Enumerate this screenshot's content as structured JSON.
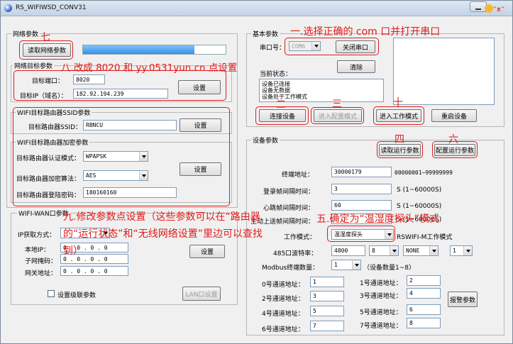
{
  "window": {
    "title": "RS_WIFIWSD_CONV31"
  },
  "network": {
    "legend": "网络参数",
    "read_button": "读取网络参数",
    "progress_fraction": 0.78,
    "target_legend": "网络目标参数",
    "port_label": "目标端口：",
    "port_value": "8020",
    "ip_label": "目标IP（域名）：",
    "ip_value": "182.92.194.239",
    "set_button_1": "设置",
    "ssid_legend": "WIFI目标路由器SSID参数",
    "ssid_label": "目标路由器SSID：",
    "ssid_value": "RBNCU",
    "set_button_2": "设置",
    "enc_legend": "WIFI目标路由器加密参数",
    "auth_label": "目标路由器认证模式：",
    "auth_value": "WPAPSK",
    "algo_label": "目标路由器加密算法：",
    "algo_value": "AES",
    "pwd_label": "目标路由器登陆密码：",
    "pwd_value": "180160160",
    "set_button_3": "设置"
  },
  "wifi_wan": {
    "legend": "WIFI-WAN口参数",
    "ip_mode_label": "IP获取方式：",
    "ip_mode_value": "",
    "local_ip_label": "本地IP：",
    "local_ip_value": "0 . 0 . 0 . 0",
    "mask_label": "子网掩码：",
    "mask_value": "0 . 0 . 0 . 0",
    "gateway_label": "网关地址：",
    "gateway_value": "0 . 0 . 0 . 0",
    "set_button": "设置",
    "cascade_label": "设置级联参数",
    "lan_button": "LAN口设置"
  },
  "basic": {
    "legend": "基本参数",
    "port_label": "串口号：",
    "port_value": "COM6",
    "close_button": "关闭串口",
    "clear_button": "清除",
    "status_label": "当前状态：",
    "status_lines": [
      "设备已连接",
      "设备无数据",
      "设备处于工作模式"
    ],
    "connect_button": "连接设备",
    "config_button": "进入配置模式",
    "work_button": "进入工作模式",
    "restart_button": "重启设备"
  },
  "device": {
    "legend": "设备参数",
    "read_run_button": "读取运行参数",
    "config_run_button": "配置运行参数",
    "terminal_label": "终端地址：",
    "terminal_value": "30000179",
    "terminal_range": "00000001~99999999",
    "login_label": "登录帧间隔时间：",
    "login_value": "3",
    "login_unit": "S (1~60000S)",
    "heartbeat_label": "心跳帧间隔时间：",
    "heartbeat_value": "60",
    "heartbeat_unit": "S (1~60000S)",
    "report_label": "主动上送帧间隔时间：",
    "report_value": "",
    "report_unit": "S (1~60000S)",
    "mode_label": "工作模式：",
    "mode_value": "温湿度探头",
    "mode_suffix": "RSWIFI-M工作模式",
    "baud_label": "485口波特率：",
    "baud_value": "4800",
    "databits_value": "8",
    "parity_value": "NONE",
    "stopbits_value": "1",
    "modbus_label": "Modbus终端数量：",
    "modbus_value": "1",
    "modbus_hint": "（设备数量1~8）",
    "alarm_button": "报警参数",
    "channels": [
      {
        "label": "0号通道地址：",
        "value": "1"
      },
      {
        "label": "1号通道地址：",
        "value": "2"
      },
      {
        "label": "2号通道地址：",
        "value": "3"
      },
      {
        "label": "3号通道地址：",
        "value": "4"
      },
      {
        "label": "4号通道地址：",
        "value": "5"
      },
      {
        "label": "5号通道地址：",
        "value": "6"
      },
      {
        "label": "6号通道地址：",
        "value": "7"
      },
      {
        "label": "7号通道地址：",
        "value": "8"
      }
    ]
  },
  "annotations": {
    "a1": "一.选择正确的 com 口并打开串口",
    "a2": "二",
    "a3": "三",
    "a4": "四",
    "a5": "五.确定为“温湿度探头”模式",
    "a6": "六",
    "a7": "七",
    "a8": "八.改成 8020 和 yy.0531yun.cn 点设置",
    "a9": "九.修改参数点设置（这些参数可以在“路由器的“运行状态”和“无线网络设置”里边可以查找到）",
    "a10": "十"
  },
  "colors": {
    "annotation_red": "#e01c1c",
    "progress_blue": "#3a8fe8"
  }
}
